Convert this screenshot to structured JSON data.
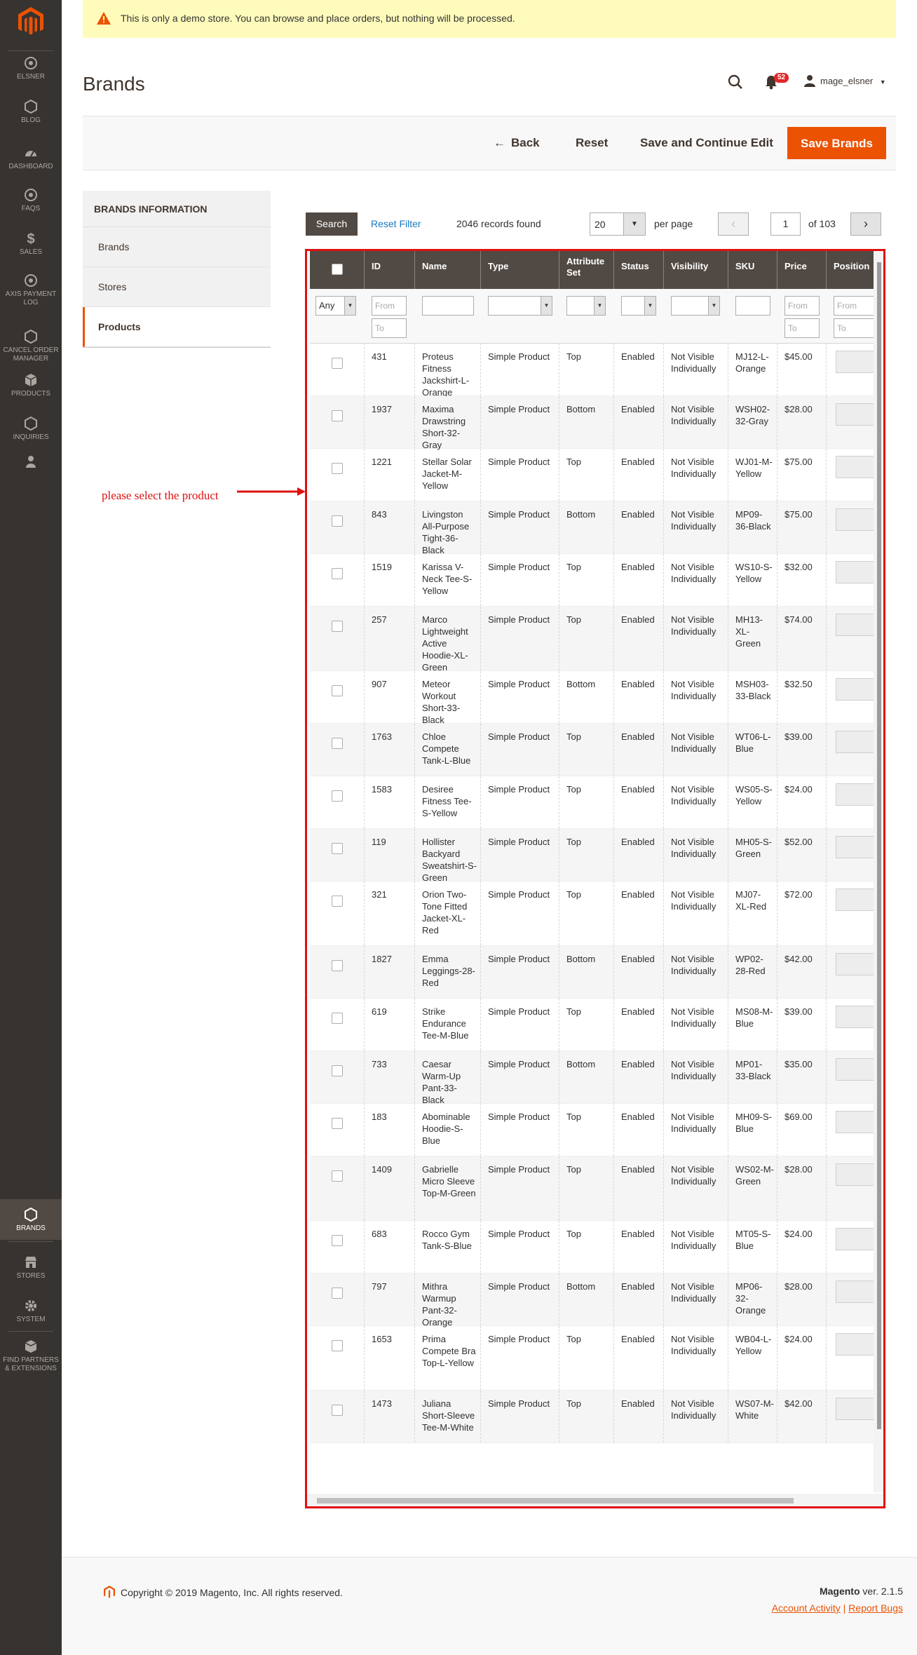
{
  "notice": "This is only a demo store. You can browse and place orders, but nothing will be processed.",
  "menu": [
    {
      "label": "ELSNER",
      "icon": "elsner-icon"
    },
    {
      "label": "BLOG",
      "icon": "blog-icon"
    },
    {
      "label": "DASHBOARD",
      "icon": "dashboard-icon"
    },
    {
      "label": "FAQS",
      "icon": "faqs-icon"
    },
    {
      "label": "SALES",
      "icon": "dollar-icon"
    },
    {
      "label": "AXIS PAYMENT LOG",
      "icon": "axis-icon"
    },
    {
      "label": "CANCEL ORDER MANAGER",
      "icon": "cancel-order-icon"
    },
    {
      "label": "PRODUCTS",
      "icon": "box-icon"
    },
    {
      "label": "INQUIRIES",
      "icon": "inquiries-icon"
    },
    {
      "label": "",
      "icon": "user-icon"
    },
    {
      "label": "BRANDS",
      "icon": "brands-icon"
    },
    {
      "label": "STORES",
      "icon": "store-icon"
    },
    {
      "label": "SYSTEM",
      "icon": "gear-icon"
    },
    {
      "label": "FIND PARTNERS & EXTENSIONS",
      "icon": "partners-icon"
    }
  ],
  "header": {
    "title": "Brands",
    "notifications": "52",
    "user": "mage_elsner"
  },
  "actions": {
    "back": "Back",
    "reset": "Reset",
    "save_continue": "Save and Continue Edit",
    "save": "Save Brands"
  },
  "tabs": {
    "heading": "BRANDS INFORMATION",
    "items": [
      "Brands",
      "Stores",
      "Products"
    ]
  },
  "grid": {
    "search": "Search",
    "reset_filter": "Reset Filter",
    "records": "2046 records found",
    "per_page_value": "20",
    "per_page_label": "per page",
    "page": "1",
    "of_pages": "of 103",
    "columns": [
      "ID",
      "Name",
      "Type",
      "Attribute Set",
      "Status",
      "Visibility",
      "SKU",
      "Price",
      "Position"
    ],
    "filter": {
      "any": "Any",
      "from": "From",
      "to": "To"
    },
    "rows": [
      {
        "id": "431",
        "name": "Proteus Fitness Jackshirt-L-Orange",
        "type": "Simple Product",
        "set": "Top",
        "status": "Enabled",
        "vis": "Not Visible Individually",
        "sku": "MJ12-L-Orange",
        "price": "$45.00"
      },
      {
        "id": "1937",
        "name": "Maxima Drawstring Short-32-Gray",
        "type": "Simple Product",
        "set": "Bottom",
        "status": "Enabled",
        "vis": "Not Visible Individually",
        "sku": "WSH02-32-Gray",
        "price": "$28.00"
      },
      {
        "id": "1221",
        "name": "Stellar Solar Jacket-M-Yellow",
        "type": "Simple Product",
        "set": "Top",
        "status": "Enabled",
        "vis": "Not Visible Individually",
        "sku": "WJ01-M-Yellow",
        "price": "$75.00"
      },
      {
        "id": "843",
        "name": "Livingston All-Purpose Tight-36-Black",
        "type": "Simple Product",
        "set": "Bottom",
        "status": "Enabled",
        "vis": "Not Visible Individually",
        "sku": "MP09-36-Black",
        "price": "$75.00"
      },
      {
        "id": "1519",
        "name": "Karissa V-Neck Tee-S-Yellow",
        "type": "Simple Product",
        "set": "Top",
        "status": "Enabled",
        "vis": "Not Visible Individually",
        "sku": "WS10-S-Yellow",
        "price": "$32.00"
      },
      {
        "id": "257",
        "name": "Marco Lightweight Active Hoodie-XL-Green",
        "type": "Simple Product",
        "set": "Top",
        "status": "Enabled",
        "vis": "Not Visible Individually",
        "sku": "MH13-XL-Green",
        "price": "$74.00"
      },
      {
        "id": "907",
        "name": "Meteor Workout Short-33-Black",
        "type": "Simple Product",
        "set": "Bottom",
        "status": "Enabled",
        "vis": "Not Visible Individually",
        "sku": "MSH03-33-Black",
        "price": "$32.50"
      },
      {
        "id": "1763",
        "name": "Chloe Compete Tank-L-Blue",
        "type": "Simple Product",
        "set": "Top",
        "status": "Enabled",
        "vis": "Not Visible Individually",
        "sku": "WT06-L-Blue",
        "price": "$39.00"
      },
      {
        "id": "1583",
        "name": "Desiree Fitness Tee-S-Yellow",
        "type": "Simple Product",
        "set": "Top",
        "status": "Enabled",
        "vis": "Not Visible Individually",
        "sku": "WS05-S-Yellow",
        "price": "$24.00"
      },
      {
        "id": "119",
        "name": "Hollister Backyard Sweatshirt-S-Green",
        "type": "Simple Product",
        "set": "Top",
        "status": "Enabled",
        "vis": "Not Visible Individually",
        "sku": "MH05-S-Green",
        "price": "$52.00"
      },
      {
        "id": "321",
        "name": "Orion Two-Tone Fitted Jacket-XL-Red",
        "type": "Simple Product",
        "set": "Top",
        "status": "Enabled",
        "vis": "Not Visible Individually",
        "sku": "MJ07-XL-Red",
        "price": "$72.00"
      },
      {
        "id": "1827",
        "name": "Emma Leggings-28-Red",
        "type": "Simple Product",
        "set": "Bottom",
        "status": "Enabled",
        "vis": "Not Visible Individually",
        "sku": "WP02-28-Red",
        "price": "$42.00"
      },
      {
        "id": "619",
        "name": "Strike Endurance Tee-M-Blue",
        "type": "Simple Product",
        "set": "Top",
        "status": "Enabled",
        "vis": "Not Visible Individually",
        "sku": "MS08-M-Blue",
        "price": "$39.00"
      },
      {
        "id": "733",
        "name": "Caesar Warm-Up Pant-33-Black",
        "type": "Simple Product",
        "set": "Bottom",
        "status": "Enabled",
        "vis": "Not Visible Individually",
        "sku": "MP01-33-Black",
        "price": "$35.00"
      },
      {
        "id": "183",
        "name": "Abominable Hoodie-S-Blue",
        "type": "Simple Product",
        "set": "Top",
        "status": "Enabled",
        "vis": "Not Visible Individually",
        "sku": "MH09-S-Blue",
        "price": "$69.00"
      },
      {
        "id": "1409",
        "name": "Gabrielle Micro Sleeve Top-M-Green",
        "type": "Simple Product",
        "set": "Top",
        "status": "Enabled",
        "vis": "Not Visible Individually",
        "sku": "WS02-M-Green",
        "price": "$28.00"
      },
      {
        "id": "683",
        "name": "Rocco Gym Tank-S-Blue",
        "type": "Simple Product",
        "set": "Top",
        "status": "Enabled",
        "vis": "Not Visible Individually",
        "sku": "MT05-S-Blue",
        "price": "$24.00"
      },
      {
        "id": "797",
        "name": "Mithra Warmup Pant-32-Orange",
        "type": "Simple Product",
        "set": "Bottom",
        "status": "Enabled",
        "vis": "Not Visible Individually",
        "sku": "MP06-32-Orange",
        "price": "$28.00"
      },
      {
        "id": "1653",
        "name": "Prima Compete Bra Top-L-Yellow",
        "type": "Simple Product",
        "set": "Top",
        "status": "Enabled",
        "vis": "Not Visible Individually",
        "sku": "WB04-L-Yellow",
        "price": "$24.00"
      },
      {
        "id": "1473",
        "name": "Juliana Short-Sleeve Tee-M-White",
        "type": "Simple Product",
        "set": "Top",
        "status": "Enabled",
        "vis": "Not Visible Individually",
        "sku": "WS07-M-White",
        "price": "$42.00"
      }
    ]
  },
  "annotation": "please select the product",
  "footer": {
    "copyright": "Copyright © 2019 Magento, Inc. All rights reserved.",
    "brand": "Magento",
    "version": "ver. 2.1.5",
    "account_activity": "Account Activity",
    "separator": "|",
    "report_bugs": "Report Bugs"
  },
  "colors": {
    "accent": "#eb5202",
    "sidebar": "#373330",
    "grid_header": "#514943",
    "annotation": "#e01010",
    "link": "#1979c3"
  }
}
